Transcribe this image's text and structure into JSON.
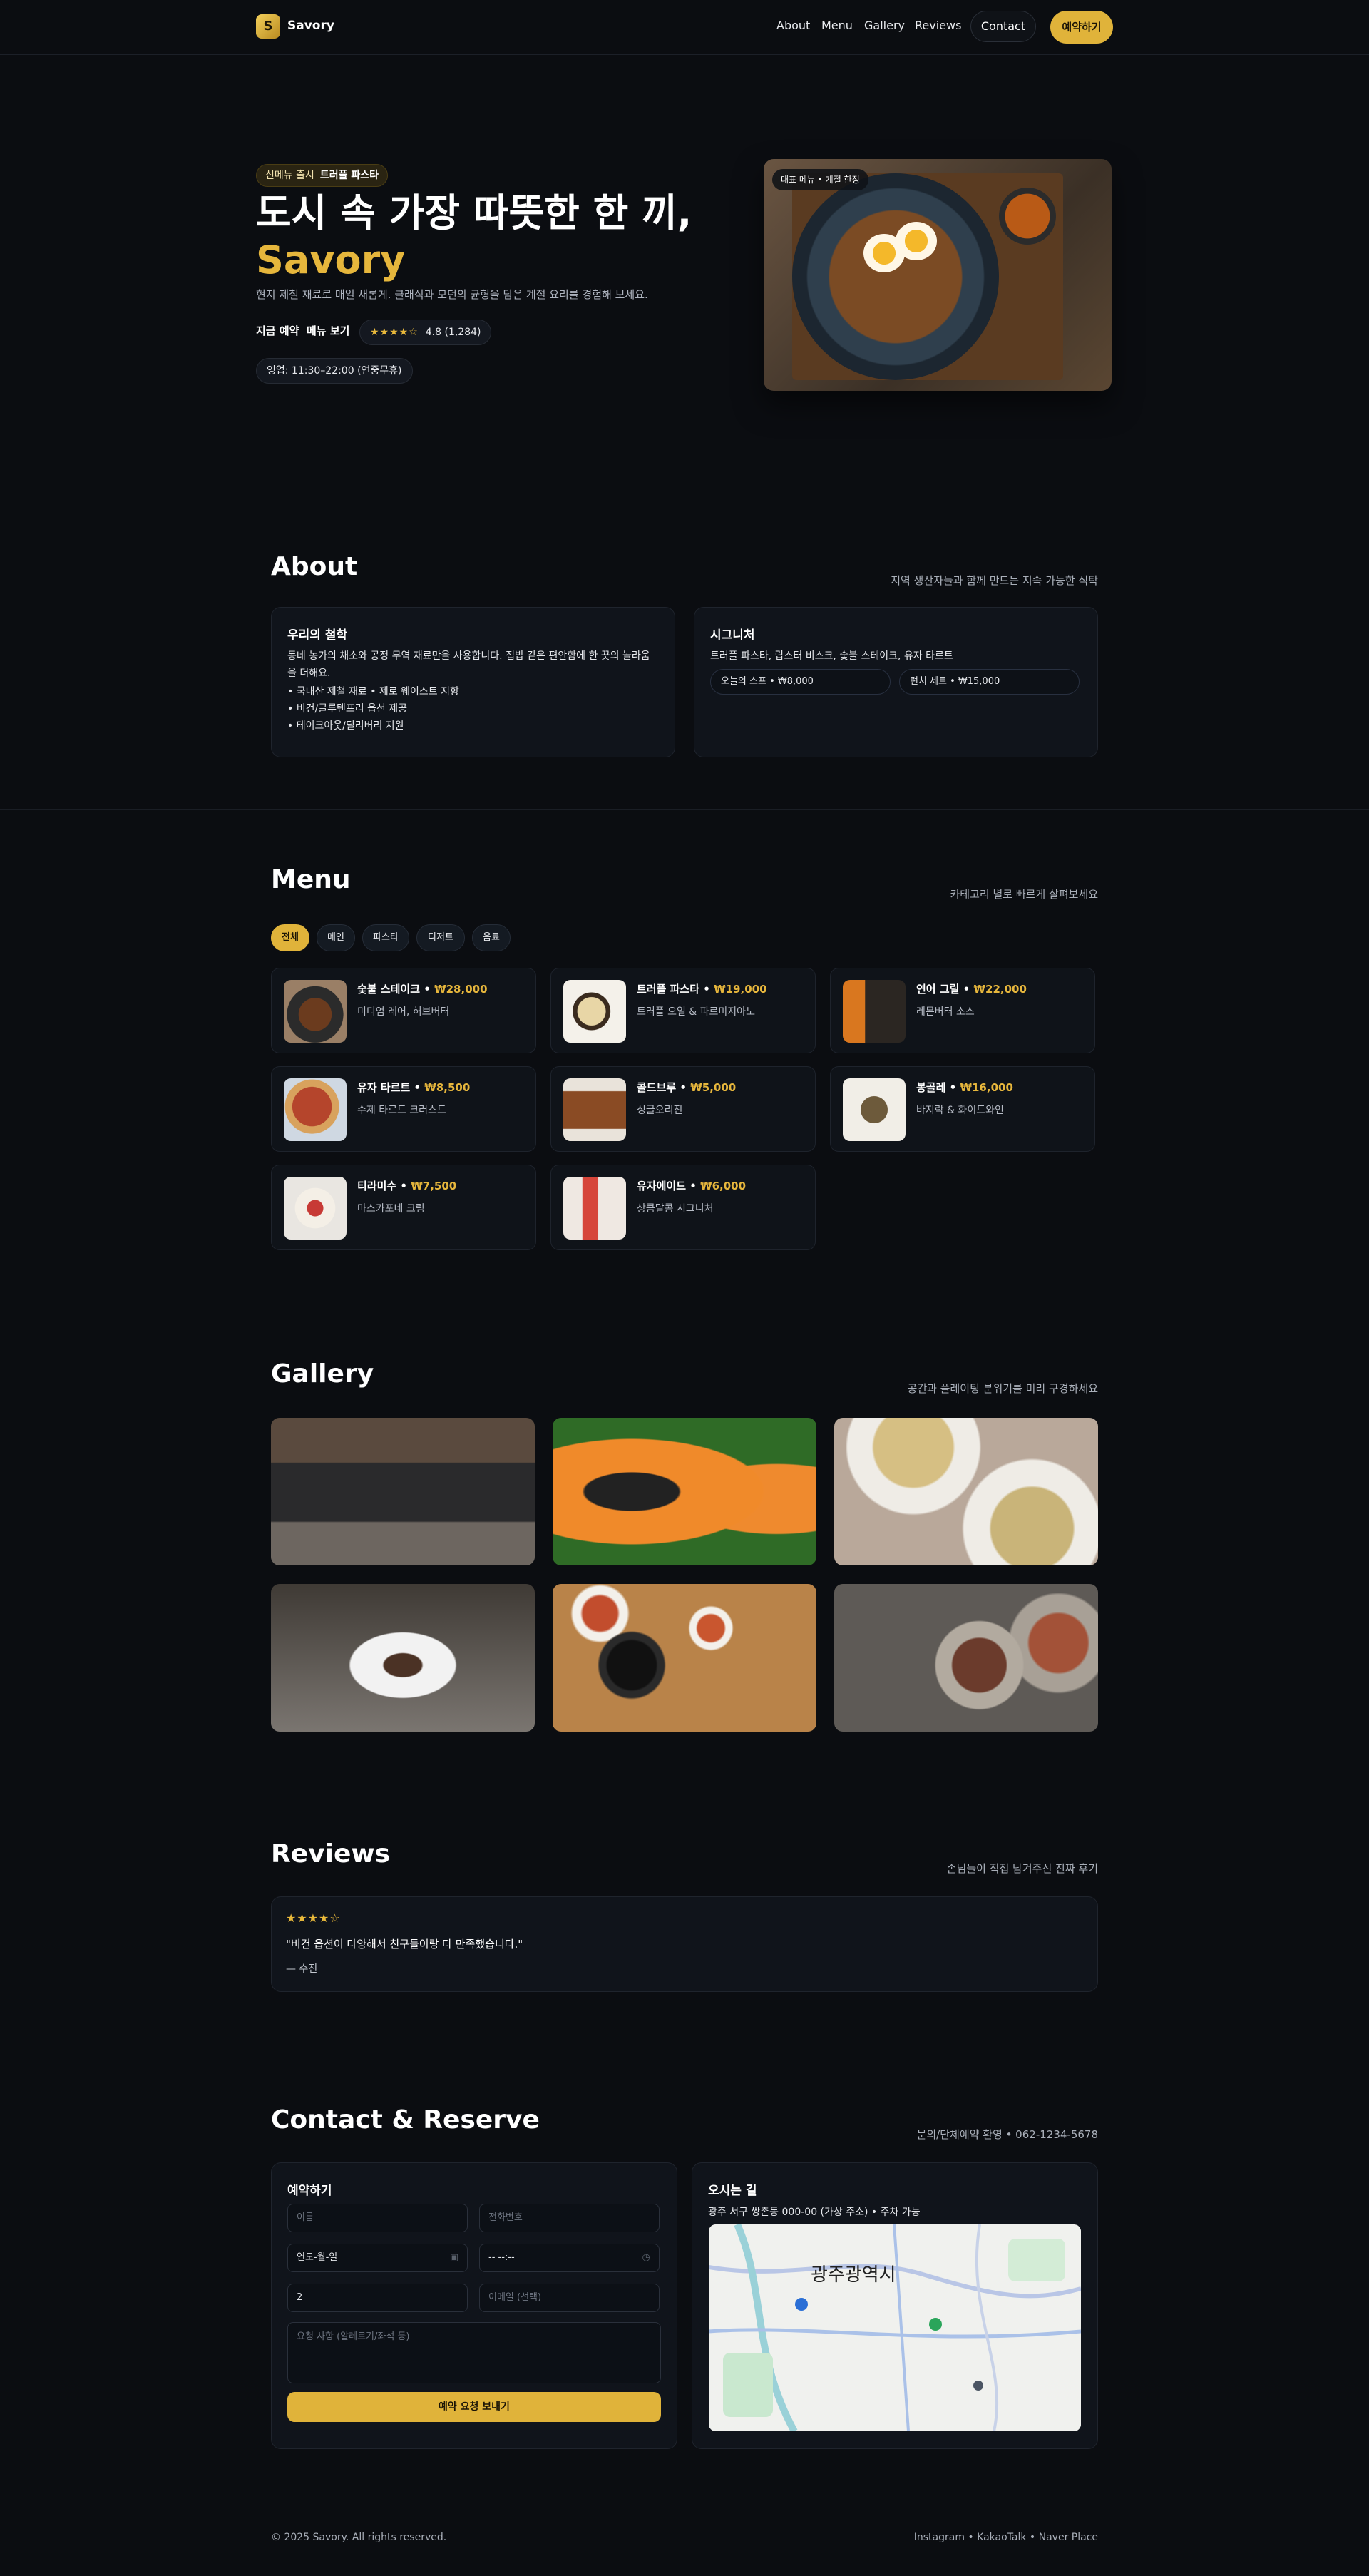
{
  "brand": {
    "logo_glyph": "S",
    "name": "Savory",
    "accent": "#e0b33a"
  },
  "nav": {
    "about": "About",
    "menu": "Menu",
    "gallery": "Gallery",
    "reviews": "Reviews",
    "contact": "Contact",
    "reserve": "예약하기"
  },
  "hero": {
    "pill_label": "신메뉴 출시",
    "pill_item": "트러플 파스타",
    "title_line1": "도시 속 가장 따뜻한 한 끼,",
    "title_line2": "Savory",
    "subtitle": "현지 제철 재료로 매일 새롭게. 클래식과 모던의 균형을 담은 계절 요리를 경험해 보세요.",
    "link_reserve": "지금 예약",
    "link_menu": "메뉴 보기",
    "stars": "★★★★☆",
    "rating": "4.8 (1,284)",
    "hours": "영업: 11:30–22:00 (연중무휴)",
    "image_badge": "대표 메뉴 • 계절 한정"
  },
  "about": {
    "title": "About",
    "subtitle": "지역 생산자들과 함께 만드는 지속 가능한 식탁",
    "philosophy_title": "우리의 철학",
    "philosophy_text": "동네 농가의 채소와 공정 무역 재료만을 사용합니다. 집밥 같은 편안함에 한 끗의 놀라움을 더해요.",
    "bullets": [
      "국내산 제철 재료 • 제로 웨이스트 지향",
      "비건/글루텐프리 옵션 제공",
      "테이크아웃/딜리버리 지원"
    ],
    "signature_title": "시그니처",
    "signature_text": "트러플 파스타, 랍스터 비스크, 숯불 스테이크, 유자 타르트",
    "chip1": "오늘의 스프 • ₩8,000",
    "chip2": "런치 세트 • ₩15,000"
  },
  "menu": {
    "title": "Menu",
    "subtitle": "카테고리 별로 빠르게 살펴보세요",
    "filters": [
      "전체",
      "메인",
      "파스타",
      "디저트",
      "음료"
    ],
    "items": [
      {
        "name": "숯불 스테이크",
        "price": "₩28,000",
        "desc": "미디엄 레어, 허브버터"
      },
      {
        "name": "트러플 파스타",
        "price": "₩19,000",
        "desc": "트러플 오일 & 파르미지아노"
      },
      {
        "name": "연어 그릴",
        "price": "₩22,000",
        "desc": "레몬버터 소스"
      },
      {
        "name": "유자 타르트",
        "price": "₩8,500",
        "desc": "수제 타르트 크러스트"
      },
      {
        "name": "콜드브루",
        "price": "₩5,000",
        "desc": "싱글오리진"
      },
      {
        "name": "봉골레",
        "price": "₩16,000",
        "desc": "바지락 & 화이트와인"
      },
      {
        "name": "티라미수",
        "price": "₩7,500",
        "desc": "마스카포네 크림"
      },
      {
        "name": "유자에이드",
        "price": "₩6,000",
        "desc": "상큼달콤 시그니처"
      }
    ]
  },
  "gallery": {
    "title": "Gallery",
    "subtitle": "공간과 플레이팅 분위기를 미리 구경하세요"
  },
  "reviews": {
    "title": "Reviews",
    "subtitle": "손님들이 직접 남겨주신 진짜 후기",
    "stars": "★★★★☆",
    "quote": "\"비건 옵션이 다양해서 친구들이랑 다 만족했습니다.\"",
    "author": "— 수진"
  },
  "contact": {
    "title": "Contact & Reserve",
    "subtitle": "문의/단체예약 환영 • 062-1234-5678",
    "form_title": "예약하기",
    "name_placeholder": "이름",
    "phone_placeholder": "전화번호",
    "date_value": "연도-월-일",
    "time_value": "-- --:--",
    "guests_value": "2",
    "email_placeholder": "이메일 (선택)",
    "request_placeholder": "요청 사항 (알레르기/좌석 등)",
    "submit": "예약 요청 보내기",
    "directions_title": "오시는 길",
    "address": "광주 서구 쌍촌동 000-00 (가상 주소) • 주차 가능",
    "map_label": "광주광역시"
  },
  "footer": {
    "copyright": "© 2025 Savory. All rights reserved.",
    "links": "Instagram • KakaoTalk • Naver Place"
  }
}
